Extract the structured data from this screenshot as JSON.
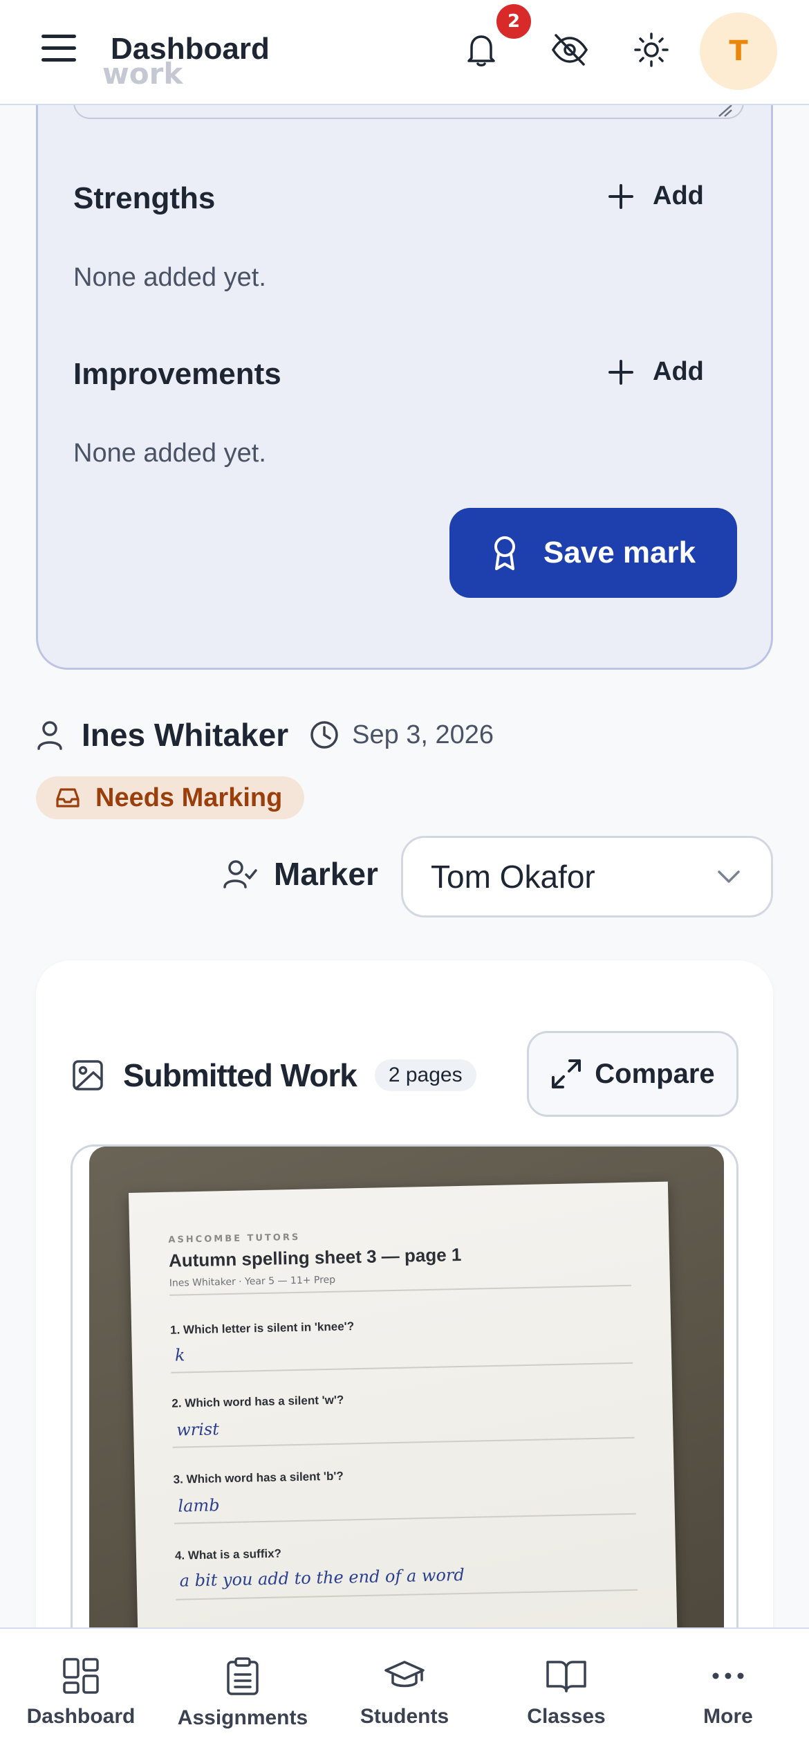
{
  "header": {
    "title": "Dashboard",
    "behind_text": "work",
    "notification_count": "2",
    "avatar_initial": "T"
  },
  "marking": {
    "strengths_title": "Strengths",
    "improvements_title": "Improvements",
    "add_label": "Add",
    "none_text": "None added yet.",
    "save_label": "Save mark"
  },
  "submission": {
    "student_name": "Ines Whitaker",
    "date": "Sep 3, 2026",
    "status": "Needs Marking",
    "marker_label": "Marker",
    "marker_value": "Tom Okafor"
  },
  "work": {
    "title": "Submitted Work",
    "pages": "2 pages",
    "compare_label": "Compare",
    "sheet": {
      "org": "ASHCOMBE TUTORS",
      "title": "Autumn spelling sheet 3 — page 1",
      "subtitle": "Ines Whitaker · Year 5 — 11+ Prep",
      "questions": [
        {
          "q": "1. Which letter is silent in 'knee'?",
          "a": "k"
        },
        {
          "q": "2. Which word has a silent 'w'?",
          "a": "wrist"
        },
        {
          "q": "3. Which word has a silent 'b'?",
          "a": "lamb"
        },
        {
          "q": "4. What is a suffix?",
          "a": "a bit you add to the end of a word"
        }
      ]
    }
  },
  "nav": {
    "items": [
      {
        "label": "Dashboard",
        "icon": "grid-icon"
      },
      {
        "label": "Assignments",
        "icon": "clipboard-icon"
      },
      {
        "label": "Students",
        "icon": "graduation-cap-icon"
      },
      {
        "label": "Classes",
        "icon": "book-icon"
      },
      {
        "label": "More",
        "icon": "more-dots-icon"
      }
    ]
  },
  "colors": {
    "primary": "#1e40af",
    "badge": "#d92a2a",
    "status_bg": "#f5e4d8",
    "status_fg": "#9a3f0c",
    "avatar_bg": "#fdebd2",
    "avatar_fg": "#e8870c"
  }
}
